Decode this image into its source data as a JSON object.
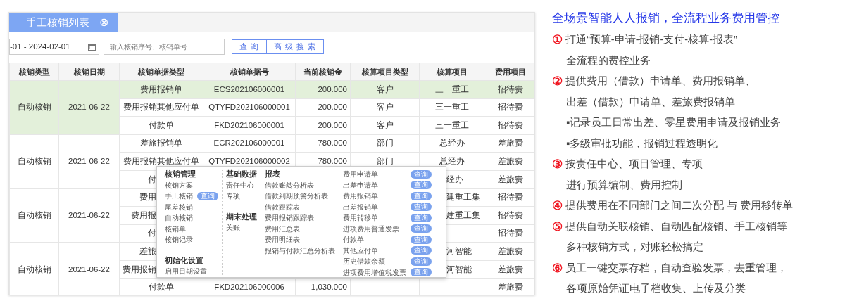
{
  "panel": {
    "tab": {
      "label": "手工核销列表",
      "close": "⊗"
    },
    "search": {
      "date_value": "-01 - 2024-02-01",
      "placeholder": "输入核销序号、核销单号",
      "buttons": [
        "查询",
        "高级搜索"
      ]
    },
    "columns": [
      "核销类型",
      "核销日期",
      "核销单据类型",
      "核销单据号",
      "当前核销金",
      "核算项目类型",
      "核算项目",
      "费用项目"
    ],
    "groups": [
      {
        "type": "自动核销",
        "date": "2021-06-22",
        "selected": true,
        "rows": [
          {
            "selected": true,
            "covered": false,
            "doc_type": "费用报销单",
            "doc_no": "ECS202106000001",
            "amount": "200.000",
            "item_type": "客户",
            "item": "三一重工",
            "expense": "招待费"
          },
          {
            "selected": false,
            "covered": false,
            "doc_type": "费用报销其他应付单",
            "doc_no": "QTYFD202106000001",
            "amount": "200.000",
            "item_type": "客户",
            "item": "三一重工",
            "expense": "招待费"
          },
          {
            "selected": false,
            "covered": false,
            "doc_type": "付款单",
            "doc_no": "FKD202106000001",
            "amount": "200.000",
            "item_type": "客户",
            "item": "三一重工",
            "expense": "招待费"
          }
        ]
      },
      {
        "type": "自动核销",
        "date": "2021-06-22",
        "selected": false,
        "rows": [
          {
            "selected": false,
            "covered": false,
            "doc_type": "差旅报销单",
            "doc_no": "ECR202106000001",
            "amount": "780.000",
            "item_type": "部门",
            "item": "总经办",
            "expense": "差旅费"
          },
          {
            "selected": false,
            "covered": false,
            "doc_type": "费用报销其他应付单",
            "doc_no": "QTYFD202106000002",
            "amount": "780.000",
            "item_type": "部门",
            "item": "总经办",
            "expense": "差旅费"
          },
          {
            "selected": false,
            "covered": true,
            "doc_type": "付",
            "item": "经办",
            "expense": "差旅费"
          }
        ]
      },
      {
        "type": "自动核销",
        "date": "2021-06-22",
        "selected": false,
        "rows": [
          {
            "selected": false,
            "covered": true,
            "doc_type": "费用",
            "item": "建重工集",
            "expense": "招待费"
          },
          {
            "selected": false,
            "covered": true,
            "doc_type": "费用报",
            "item": "建重工集",
            "expense": "招待费"
          },
          {
            "selected": false,
            "covered": true,
            "doc_type": "付",
            "expense": "招待费"
          }
        ]
      },
      {
        "type": "自动核销",
        "date": "2021-06-22",
        "selected": false,
        "rows": [
          {
            "selected": false,
            "covered": true,
            "doc_type": "差旅",
            "item": "河智能",
            "expense": "差旅费"
          },
          {
            "selected": false,
            "covered": true,
            "doc_type": "费用报销",
            "item": "河智能",
            "expense": "差旅费"
          },
          {
            "selected": false,
            "covered": false,
            "doc_type": "付款单",
            "doc_no": "FKD202106000006",
            "amount": "1,030.000",
            "expense": "差旅费"
          }
        ]
      }
    ],
    "menu": {
      "columns": [
        [
          {
            "heading": "核销管理",
            "items": [
              {
                "label": "核销方案"
              },
              {
                "label": "手工核销",
                "action": "查询"
              },
              {
                "label": "尾差核销"
              },
              {
                "label": "自动核销"
              },
              {
                "label": "核销单"
              },
              {
                "label": "核销记录"
              }
            ]
          },
          {
            "heading": "初始化设置",
            "items": [
              {
                "label": "启用日期设置"
              }
            ]
          }
        ],
        [
          {
            "heading": "基础数据",
            "items": [
              {
                "label": "责任中心"
              },
              {
                "label": "专项"
              }
            ]
          },
          {
            "heading": "期末处理",
            "items": [
              {
                "label": "关账"
              }
            ]
          }
        ],
        [
          {
            "heading": "报表",
            "items": [
              {
                "label": "借款账龄分析表"
              },
              {
                "label": "借款到期预警分析表"
              },
              {
                "label": "借款跟踪表"
              },
              {
                "label": "费用报销跟踪表"
              },
              {
                "label": "费用汇总表"
              },
              {
                "label": "费用明细表"
              },
              {
                "label": "报销与付款汇总分析表"
              }
            ]
          }
        ],
        [
          {
            "items": [
              {
                "label": "费用申请单",
                "action": "查询"
              },
              {
                "label": "出差申请单",
                "action": "查询"
              },
              {
                "label": "费用报销单",
                "action": "查询"
              },
              {
                "label": "出差报销单",
                "action": "查询"
              },
              {
                "label": "费用转移单",
                "action": "查询"
              },
              {
                "label": "进项费用普通发票",
                "action": "查询"
              },
              {
                "label": "付款单",
                "action": "查询"
              },
              {
                "label": "其他应付单",
                "action": "查询"
              },
              {
                "label": "历史借款余额",
                "action": "查询"
              },
              {
                "label": "进项费用增值税发票",
                "action": "查询"
              }
            ]
          }
        ]
      ]
    }
  },
  "features": {
    "title": "全场景智能人人报销，全流程业务费用管控",
    "items": [
      {
        "number": "①",
        "lines": [
          "打通“预算-申请-报销-支付-核算-报表”",
          "全流程的费控业务"
        ]
      },
      {
        "number": "②",
        "lines": [
          "提供费用（借款）申请单、费用报销单、",
          "出差（借款）申请单、差旅费报销单",
          "▪记录员工日常出差、零星费用申请及报销业务",
          "▪多级审批功能，报销过程透明化"
        ]
      },
      {
        "number": "③",
        "lines": [
          "按责任中心、项目管理、专项",
          "进行预算编制、费用控制"
        ]
      },
      {
        "number": "④",
        "lines": [
          "提供费用在不同部门之间二次分配 与 费用移转单"
        ]
      },
      {
        "number": "⑤",
        "lines": [
          "提供自动关联核销、自动匹配核销、手工核销等",
          "多种核销方式，对账轻松搞定"
        ]
      },
      {
        "number": "⑥",
        "lines": [
          "员工一键交票存档，自动查验发票，去重管理，",
          "各项原始凭证电子档收集、上传及分类"
        ]
      }
    ]
  }
}
